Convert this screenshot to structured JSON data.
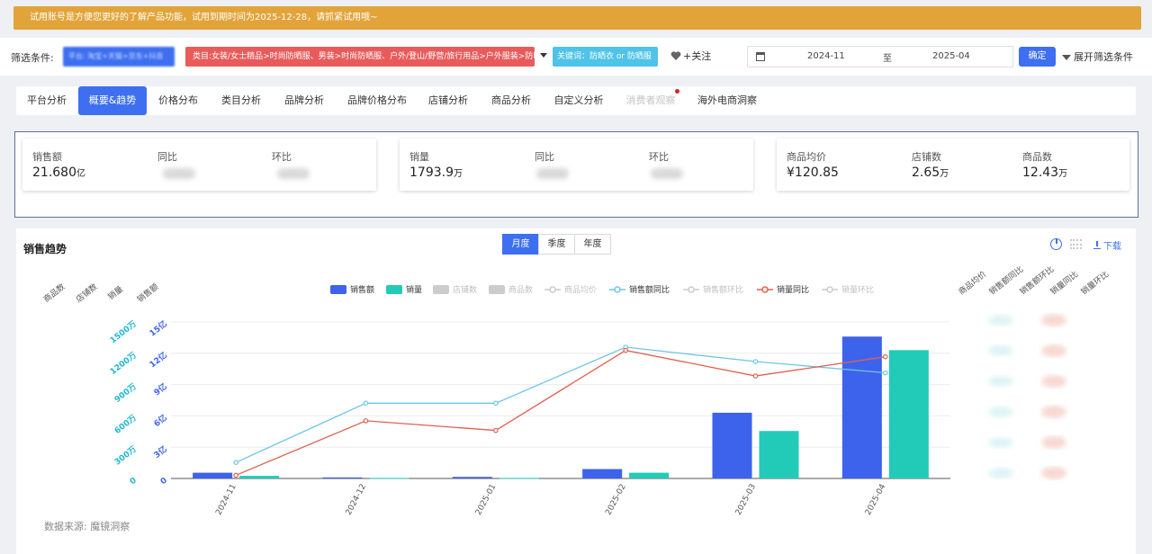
{
  "banner": {
    "text": "试用账号是方便您更好的了解产品功能，试用到期时间为2025-12-28，请抓紧试用哦~"
  },
  "filter": {
    "label": "筛选条件:",
    "platform_chip": "平台: 淘宝+天猫+京东+抖音",
    "category_chip": "类目:女装/女士精品>时尚防晒服、男装>时尚防晒服、户外/登山/野营/旅行用品>户外服装>防晒衣",
    "keyword_chip": "关键词：防晒衣 or 防晒服",
    "follow_label": "+关注",
    "date_start": "2024-11",
    "date_sep": "至",
    "date_end": "2025-04",
    "confirm_label": "确定",
    "expand_label": "展开筛选条件"
  },
  "tabs": [
    {
      "label": "平台分析"
    },
    {
      "label": "概要&趋势"
    },
    {
      "label": "价格分布"
    },
    {
      "label": "类目分析"
    },
    {
      "label": "品牌分析"
    },
    {
      "label": "品牌价格分布"
    },
    {
      "label": "店铺分析"
    },
    {
      "label": "商品分析"
    },
    {
      "label": "自定义分析"
    },
    {
      "label": "消费者观察"
    },
    {
      "label": "海外电商洞察"
    }
  ],
  "kpi": {
    "card1": {
      "sales_label": "销售额",
      "sales_value": "21.680",
      "sales_unit": "亿",
      "yoy_label": "同比",
      "mom_label": "环比"
    },
    "card2": {
      "volume_label": "销量",
      "volume_value": "1793.9",
      "volume_unit": "万",
      "yoy_label": "同比",
      "mom_label": "环比"
    },
    "card3": {
      "avg_price_label": "商品均价",
      "avg_price_value": "¥120.85",
      "shops_label": "店铺数",
      "shops_value": "2.65",
      "shops_unit": "万",
      "items_label": "商品数",
      "items_value": "12.43",
      "items_unit": "万"
    }
  },
  "trend": {
    "title": "销售趋势",
    "periods": [
      "月度",
      "季度",
      "年度"
    ],
    "active_period": "月度",
    "download_label": "下载",
    "source": "数据来源: 魔镜洞察"
  },
  "colors": {
    "accent": "#3d6ff0",
    "sales_bar": "#3d63ec",
    "volume_bar": "#22cbb8",
    "sales_yoy": "#6cc6e6",
    "volume_yoy": "#e0604f",
    "banner": "#e2a43a"
  },
  "chart_data": {
    "type": "bar",
    "categories": [
      "2024-11",
      "2024-12",
      "2025-01",
      "2025-02",
      "2025-03",
      "2025-04"
    ],
    "legend": [
      {
        "name": "销售额",
        "kind": "bar",
        "color": "#3d63ec",
        "active": true
      },
      {
        "name": "销量",
        "kind": "bar",
        "color": "#22cbb8",
        "active": true
      },
      {
        "name": "店铺数",
        "kind": "bar",
        "color": "#cccccc",
        "active": false
      },
      {
        "name": "商品数",
        "kind": "bar",
        "color": "#cccccc",
        "active": false
      },
      {
        "name": "商品均价",
        "kind": "line",
        "color": "#cccccc",
        "active": false
      },
      {
        "name": "销售额同比",
        "kind": "line",
        "color": "#6cc6e6",
        "active": true
      },
      {
        "name": "销售额环比",
        "kind": "line",
        "color": "#cccccc",
        "active": false
      },
      {
        "name": "销量同比",
        "kind": "line",
        "color": "#e0604f",
        "active": true
      },
      {
        "name": "销量环比",
        "kind": "line",
        "color": "#cccccc",
        "active": false
      }
    ],
    "left_axes": [
      {
        "name": "商品数",
        "ticks": []
      },
      {
        "name": "店铺数",
        "ticks": []
      },
      {
        "name": "销量",
        "ticks": [
          "0",
          "300万",
          "600万",
          "900万",
          "1200万",
          "1500万"
        ]
      },
      {
        "name": "销售额",
        "ticks": [
          "0",
          "3亿",
          "6亿",
          "9亿",
          "12亿",
          "15亿"
        ]
      }
    ],
    "right_axes": [
      "商品均价",
      "销售额同比",
      "销售额环比",
      "销量同比",
      "销量环比"
    ],
    "series": [
      {
        "name": "销售额",
        "unit": "亿",
        "values": [
          0.55,
          0.1,
          0.15,
          0.9,
          6.3,
          13.6
        ]
      },
      {
        "name": "销量",
        "unit": "万",
        "values": [
          25,
          5,
          5,
          55,
          455,
          1230
        ]
      },
      {
        "name": "销售额同比",
        "values": [
          0.1,
          0.47,
          0.47,
          0.82,
          0.73,
          0.66
        ]
      },
      {
        "name": "销量同比",
        "values": [
          0.02,
          0.36,
          0.3,
          0.8,
          0.64,
          0.76
        ]
      }
    ],
    "ylim": [
      0,
      15
    ]
  }
}
